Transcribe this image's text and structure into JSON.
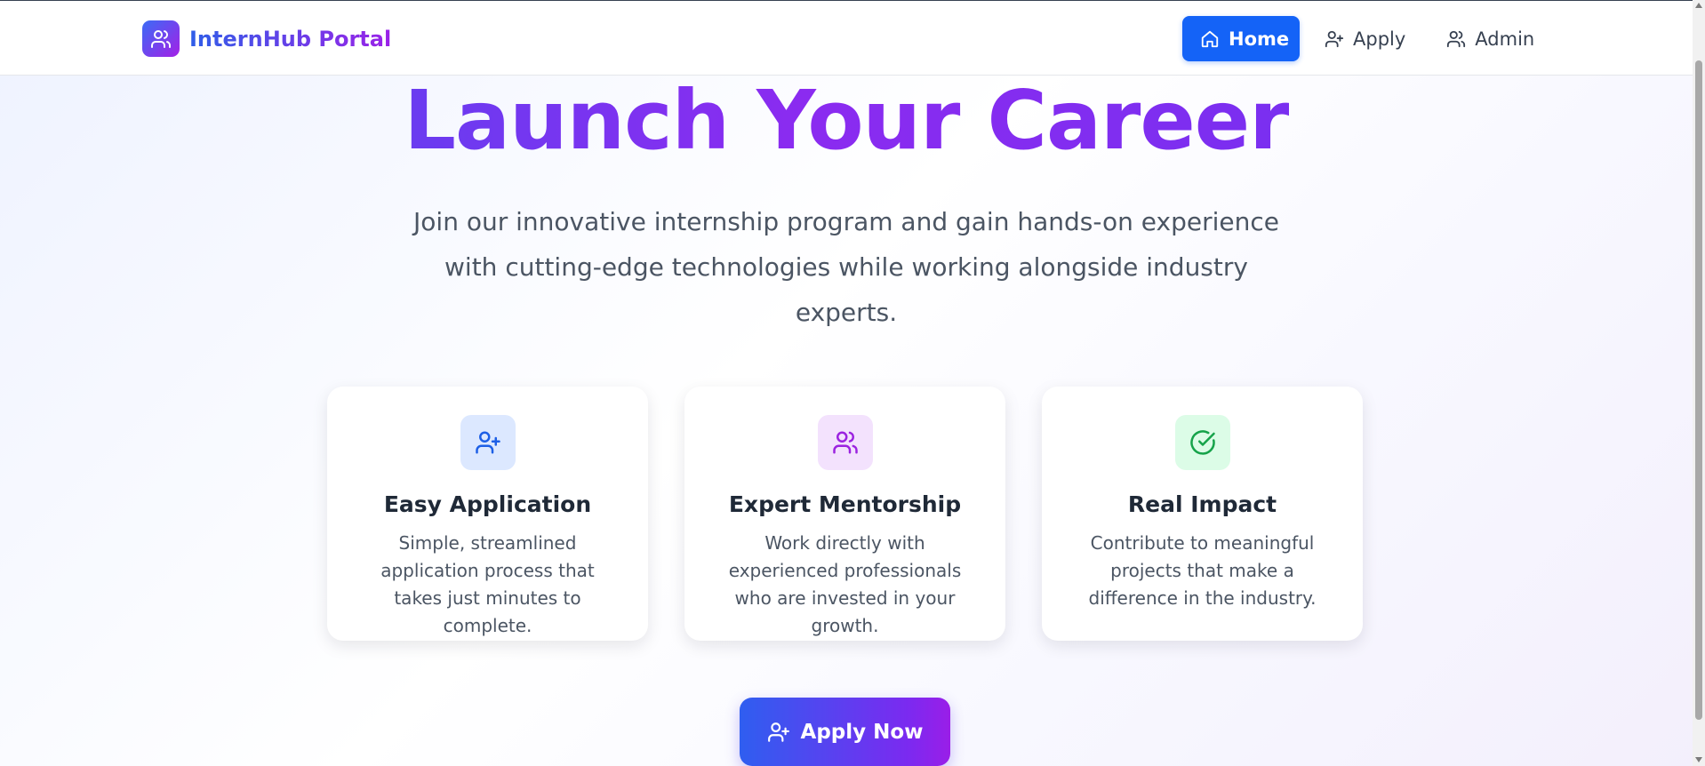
{
  "header": {
    "brand_name": "InternHub Portal",
    "brand_icon": "users-icon",
    "nav": [
      {
        "label": "Home",
        "icon": "home-icon",
        "active": true
      },
      {
        "label": "Apply",
        "icon": "user-plus-icon",
        "active": false
      },
      {
        "label": "Admin",
        "icon": "users-icon",
        "active": false
      }
    ]
  },
  "hero": {
    "title": "Launch Your Career",
    "subtitle": "Join our innovative internship program and gain hands-on experience with cutting-edge technologies while working alongside industry experts."
  },
  "features": [
    {
      "icon": "user-plus-icon",
      "title": "Easy Application",
      "text": "Simple, streamlined application process that takes just minutes to complete.",
      "accent": "#1d5fe6",
      "bg": "#dce8ff"
    },
    {
      "icon": "users-icon",
      "title": "Expert Mentorship",
      "text": "Work directly with experienced professionals who are invested in your growth.",
      "accent": "#9b22e0",
      "bg": "#f3e2fd"
    },
    {
      "icon": "check-circle-icon",
      "title": "Real Impact",
      "text": "Contribute to meaningful projects that make a difference in the industry.",
      "accent": "#16a34a",
      "bg": "#dcfce7"
    }
  ],
  "cta": {
    "label": "Apply Now",
    "icon": "user-plus-icon"
  },
  "colors": {
    "primary": "#1463f7",
    "gradient_start": "#2f5ef0",
    "gradient_end": "#9a1ee8"
  }
}
